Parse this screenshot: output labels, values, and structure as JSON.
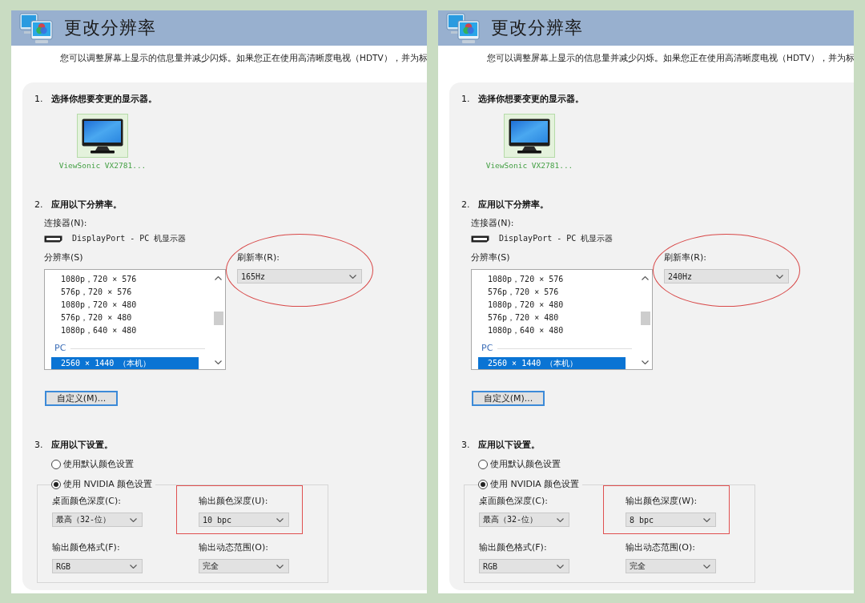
{
  "panels": [
    {
      "title": "更改分辨率",
      "description": "您可以调整屏幕上显示的信息量并减少闪烁。如果您正在使用高清晰度电视（HDTV），并为标",
      "section_1": {
        "number": "1.",
        "heading": "选择你想要变更的显示器。",
        "displays": [
          {
            "name": "ViewSonic VX2781...",
            "selected": true
          }
        ]
      },
      "section_2": {
        "number": "2.",
        "heading": "应用以下分辨率。",
        "connector_label": "连接器(N):",
        "connector": "DisplayPort - PC 机显示器",
        "resolution_label": "分辨率(S)",
        "resolutions": [
          {
            "kind": "item",
            "label": "1080p，720 × 576",
            "selected": false
          },
          {
            "kind": "item",
            "label": "576p，720 × 576",
            "selected": false
          },
          {
            "kind": "item",
            "label": "1080p，720 × 480",
            "selected": false
          },
          {
            "kind": "item",
            "label": "576p，720 × 480",
            "selected": false
          },
          {
            "kind": "item",
            "label": "1080p，640 × 480",
            "selected": false
          },
          {
            "kind": "group",
            "label": "PC"
          },
          {
            "kind": "item",
            "label": "2560 × 1440 （本机）",
            "selected": true
          }
        ],
        "refresh_rate": {
          "label": "刷新率(R):",
          "value": "165Hz",
          "circled": true
        },
        "custom_button": "自定义(M)..."
      },
      "section_3": {
        "number": "3.",
        "heading": "应用以下设置。",
        "color_modes": [
          {
            "label": "使用默认颜色设置",
            "selected": false
          },
          {
            "label": "使用 NVIDIA 颜色设置",
            "selected": true
          }
        ],
        "settings": [
          {
            "label": "桌面颜色深度(C):",
            "value": "最高（32-位）"
          },
          {
            "label": "输出颜色深度(U):",
            "value": "10 bpc",
            "boxed": true
          },
          {
            "label": "输出颜色格式(F):",
            "value": "RGB"
          },
          {
            "label": "输出动态范围(O):",
            "value": "完全"
          }
        ]
      }
    },
    {
      "title": "更改分辨率",
      "description": "您可以调整屏幕上显示的信息量并减少闪烁。如果您正在使用高清晰度电视（HDTV），并为标",
      "section_1": {
        "number": "1.",
        "heading": "选择你想要变更的显示器。",
        "displays": [
          {
            "name": "ViewSonic VX2781...",
            "selected": true
          }
        ]
      },
      "section_2": {
        "number": "2.",
        "heading": "应用以下分辨率。",
        "connector_label": "连接器(N):",
        "connector": "DisplayPort - PC 机显示器",
        "resolution_label": "分辨率(S)",
        "resolutions": [
          {
            "kind": "item",
            "label": "1080p，720 × 576",
            "selected": false
          },
          {
            "kind": "item",
            "label": "576p，720 × 576",
            "selected": false
          },
          {
            "kind": "item",
            "label": "1080p，720 × 480",
            "selected": false
          },
          {
            "kind": "item",
            "label": "576p，720 × 480",
            "selected": false
          },
          {
            "kind": "item",
            "label": "1080p，640 × 480",
            "selected": false
          },
          {
            "kind": "group",
            "label": "PC"
          },
          {
            "kind": "item",
            "label": "2560 × 1440 （本机）",
            "selected": true
          }
        ],
        "refresh_rate": {
          "label": "刷新率(R):",
          "value": "240Hz",
          "circled": true
        },
        "custom_button": "自定义(M)..."
      },
      "section_3": {
        "number": "3.",
        "heading": "应用以下设置。",
        "color_modes": [
          {
            "label": "使用默认颜色设置",
            "selected": false
          },
          {
            "label": "使用 NVIDIA 颜色设置",
            "selected": true
          }
        ],
        "settings": [
          {
            "label": "桌面颜色深度(C):",
            "value": "最高（32-位）"
          },
          {
            "label": "输出颜色深度(W):",
            "value": "8 bpc",
            "boxed": true
          },
          {
            "label": "输出颜色格式(F):",
            "value": "RGB"
          },
          {
            "label": "输出动态范围(O):",
            "value": "完全"
          }
        ]
      }
    }
  ]
}
